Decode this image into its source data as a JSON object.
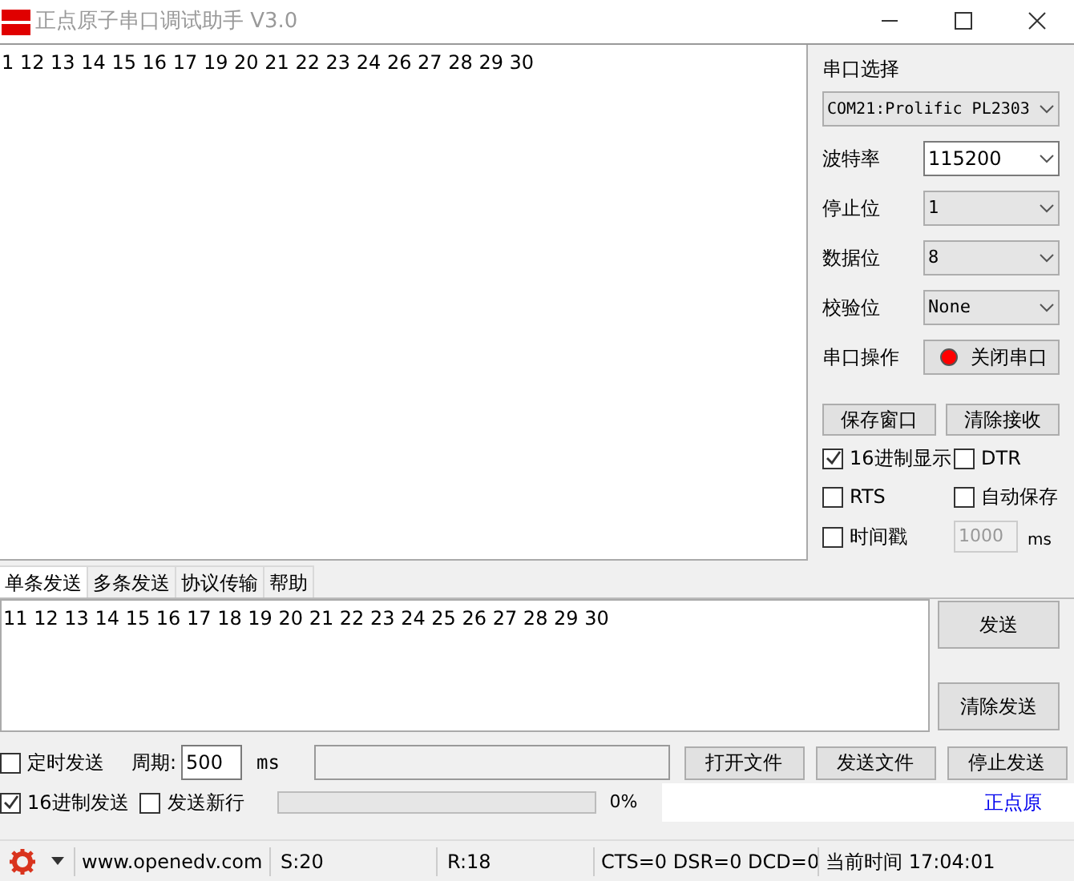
{
  "window": {
    "title": "正点原子串口调试助手 V3.0"
  },
  "receive": {
    "text": "1 12 13 14 15 16 17 19 20 21 22 23 24 26 27 28 29 30"
  },
  "panel": {
    "port_label": "串口选择",
    "port_value": "COM21:Prolific PL2303",
    "fields": [
      {
        "label": "波特率",
        "value": "115200",
        "kind": "editable"
      },
      {
        "label": "停止位",
        "value": "1",
        "kind": "readonly"
      },
      {
        "label": "数据位",
        "value": "8",
        "kind": "readonly"
      },
      {
        "label": "校验位",
        "value": "None",
        "kind": "readonly"
      }
    ],
    "operation_label": "串口操作",
    "operation_button": "关闭串口",
    "port_open": true,
    "buttons": [
      "保存窗口",
      "清除接收"
    ],
    "checkboxes": [
      {
        "label": "16进制显示",
        "checked": true
      },
      {
        "label": "DTR",
        "checked": false
      },
      {
        "label": "RTS",
        "checked": false
      },
      {
        "label": "自动保存",
        "checked": false
      },
      {
        "label": "时间戳",
        "checked": false
      }
    ],
    "interval": {
      "value": "1000",
      "unit": "ms",
      "disabled": true
    }
  },
  "tabs": [
    {
      "label": "单条发送",
      "selected": true
    },
    {
      "label": "多条发送",
      "selected": false
    },
    {
      "label": "协议传输",
      "selected": false
    },
    {
      "label": "帮助",
      "selected": false
    }
  ],
  "send": {
    "text": "11 12 13 14 15 16 17 18 19 20 21 22 23 24 25 26 27 28 29 30",
    "buttons": [
      "发送",
      "清除发送"
    ]
  },
  "options": {
    "timed": {
      "label": "定时发送",
      "checked": false
    },
    "period_label": "周期:",
    "period_value": "500",
    "period_unit": "ms",
    "file_buttons": [
      "打开文件",
      "发送文件",
      "停止发送"
    ],
    "hex_send": {
      "label": "16进制发送",
      "checked": true
    },
    "newline": {
      "label": "发送新行",
      "checked": false
    },
    "progress": {
      "level": 0,
      "reading": "0%"
    },
    "link": "正点原"
  },
  "status_bar": {
    "website": "www.openedv.com",
    "sent": "S:20",
    "received": "R:18",
    "lines": "CTS=0 DSR=0 DCD=0",
    "time": "当前时间 17:04:01"
  }
}
